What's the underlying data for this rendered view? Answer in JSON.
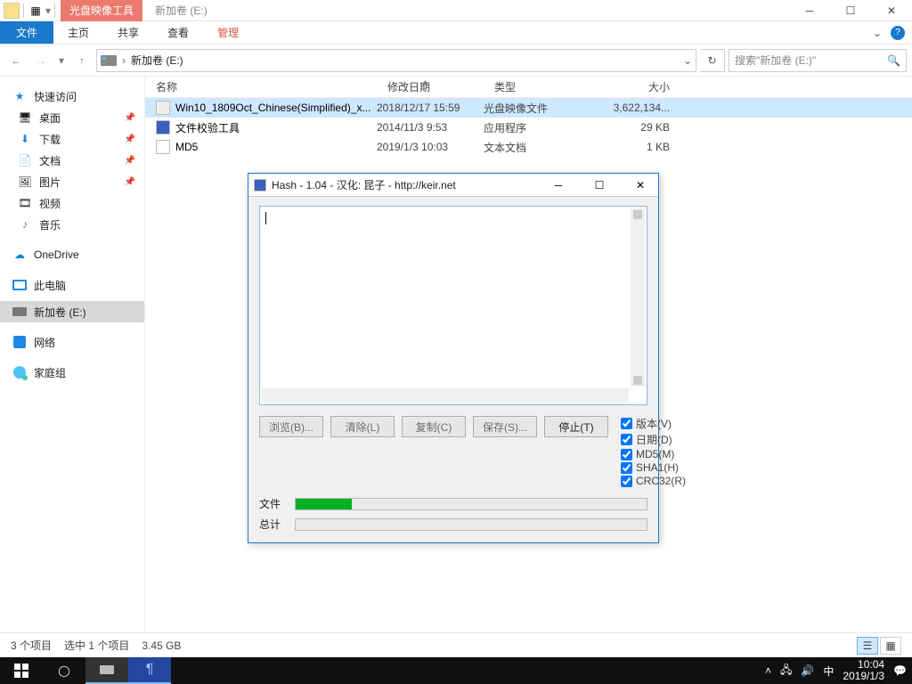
{
  "title_context_tab": "光盘映像工具",
  "window_title": "新加卷 (E:)",
  "ribbon": {
    "file": "文件",
    "home": "主页",
    "share": "共享",
    "view": "查看",
    "manage": "管理"
  },
  "address": {
    "text": "新加卷 (E:)"
  },
  "search": {
    "placeholder": "搜索\"新加卷 (E:)\""
  },
  "sidebar": {
    "quick": "快速访问",
    "items": [
      "桌面",
      "下载",
      "文档",
      "图片",
      "视频",
      "音乐"
    ],
    "onedrive": "OneDrive",
    "thispc": "此电脑",
    "drive": "新加卷 (E:)",
    "network": "网络",
    "homegroup": "家庭组"
  },
  "columns": {
    "name": "名称",
    "date": "修改日期",
    "type": "类型",
    "size": "大小"
  },
  "rows": [
    {
      "name": "Win10_1809Oct_Chinese(Simplified)_x...",
      "date": "2018/12/17 15:59",
      "type": "光盘映像文件",
      "size": "3,622,134..."
    },
    {
      "name": "文件校验工具",
      "date": "2014/11/3 9:53",
      "type": "应用程序",
      "size": "29 KB"
    },
    {
      "name": "MD5",
      "date": "2019/1/3 10:03",
      "type": "文本文档",
      "size": "1 KB"
    }
  ],
  "status": {
    "items": "3 个项目",
    "selected": "选中 1 个项目",
    "size": "3.45 GB"
  },
  "hash": {
    "title": "Hash - 1.04 - 汉化: 昆子 - http://keir.net",
    "browse": "浏览(B)...",
    "clear": "清除(L)",
    "copy": "复制(C)",
    "save": "保存(S)...",
    "stop": "停止(T)",
    "chk": [
      "版本(V)",
      "日期(D)",
      "MD5(M)",
      "SHA1(H)",
      "CRC32(R)"
    ],
    "file_label": "文件",
    "total_label": "总计"
  },
  "tray": {
    "ime": "中",
    "time": "10:04",
    "date": "2019/1/3"
  }
}
